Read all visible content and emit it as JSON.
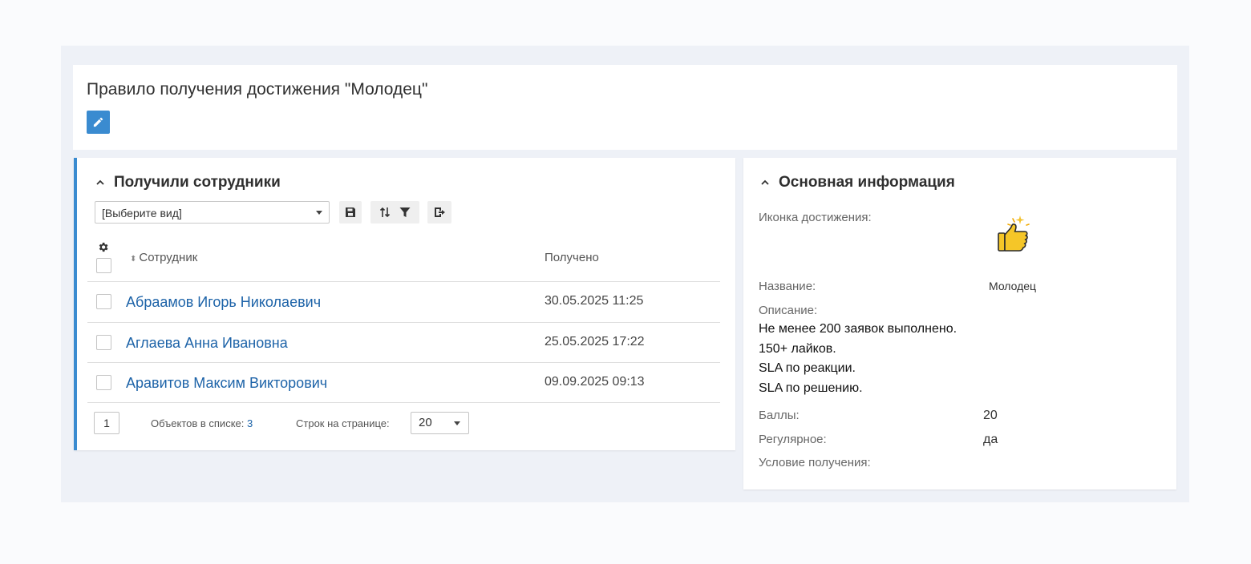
{
  "header": {
    "title": "Правило получения достижения \"Молодец\""
  },
  "employees_panel": {
    "title": "Получили сотрудники",
    "view_select": "[Выберите вид]",
    "columns": {
      "employee": "Сотрудник",
      "received": "Получено"
    },
    "rows": [
      {
        "name": "Абраамов Игорь Николаевич",
        "date": "30.05.2025 11:25"
      },
      {
        "name": "Аглаева Анна Ивановна",
        "date": "25.05.2025 17:22"
      },
      {
        "name": "Аравитов Максим Викторович",
        "date": "09.09.2025 09:13"
      }
    ],
    "pagination": {
      "page": "1",
      "objects_label": "Объектов в списке:",
      "objects_count": "3",
      "rows_label": "Строк на странице:",
      "rows_value": "20"
    }
  },
  "info_panel": {
    "title": "Основная информация",
    "icon_label": "Иконка достижения:",
    "icon": "thumbs-up-sparkle",
    "name_label": "Название:",
    "name_value": "Молодец",
    "description_label": "Описание:",
    "description_lines": [
      "Не менее 200 заявок выполнено.",
      "150+ лайков.",
      "SLA по реакции.",
      "SLA по решению."
    ],
    "points_label": "Баллы:",
    "points_value": "20",
    "regular_label": "Регулярное:",
    "regular_value": "да",
    "condition_label": "Условие получения:"
  },
  "colors": {
    "accent": "#3a8bd0",
    "link": "#1d63a8",
    "background": "#eef1f7"
  }
}
